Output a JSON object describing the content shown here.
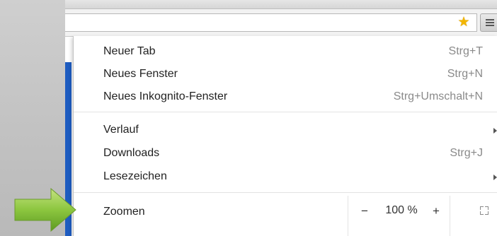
{
  "menu": {
    "items": [
      {
        "label": "Neuer Tab",
        "shortcut": "Strg+T"
      },
      {
        "label": "Neues Fenster",
        "shortcut": "Strg+N"
      },
      {
        "label": "Neues Inkognito-Fenster",
        "shortcut": "Strg+Umschalt+N"
      },
      {
        "label": "Verlauf",
        "shortcut": ""
      },
      {
        "label": "Downloads",
        "shortcut": "Strg+J"
      },
      {
        "label": "Lesezeichen",
        "shortcut": ""
      }
    ],
    "zoom": {
      "label": "Zoomen",
      "minus": "−",
      "level": "100 %",
      "plus": "+"
    }
  },
  "icons": {
    "bookmark_star": "star-icon",
    "menu": "hamburger-icon",
    "fullscreen": "fullscreen-icon",
    "pointer": "green-arrow-icon"
  },
  "colors": {
    "star": "#f3b600",
    "page_accent": "#1e5cc0",
    "arrow_green": "#8cc63f"
  }
}
